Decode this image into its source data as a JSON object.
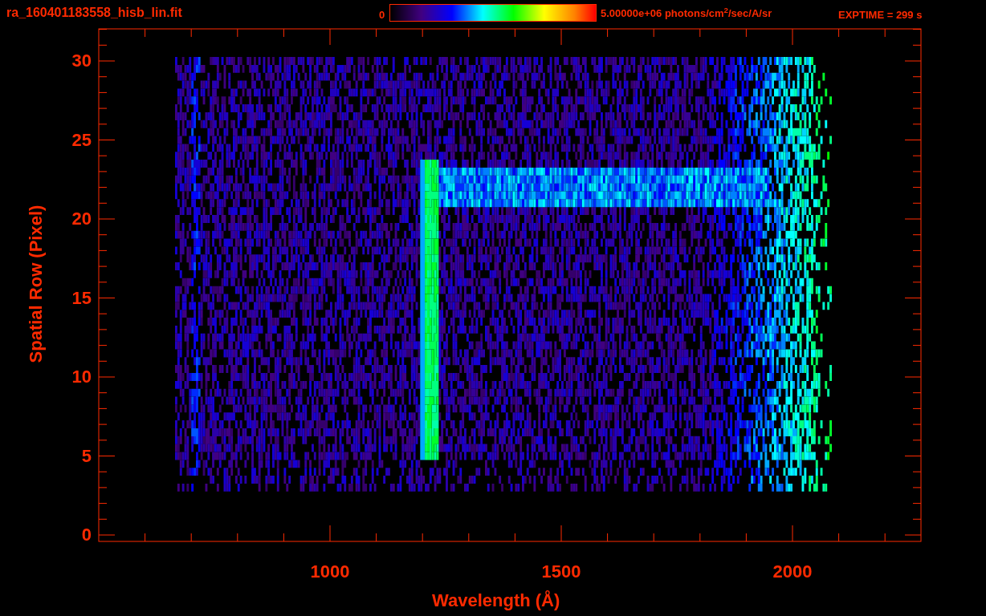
{
  "header": {
    "filename": "ra_160401183558_hisb_lin.fit",
    "colorbar": {
      "min_label": "0",
      "max_label": "5.00000e+06 photons/cm$^{2}$/sec/A/sr"
    },
    "exposure": "EXPTIME = 299 s"
  },
  "plot": {
    "xlabel": "Wavelength (Å)",
    "ylabel": "Spatial Row (Pixel)",
    "xticks": [
      "1000",
      "1500",
      "2000"
    ],
    "yticks": [
      "30",
      "25",
      "20",
      "15",
      "10",
      "5",
      "0"
    ]
  }
}
